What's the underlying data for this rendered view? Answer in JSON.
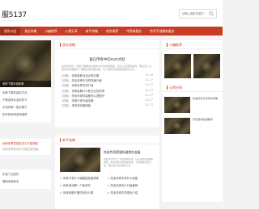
{
  "site": {
    "title": "服5137",
    "subtitle": "——————————————",
    "search_placeholder": "请输入搜索关键字..."
  },
  "nav": [
    "资讯公告",
    "现在攻略",
    "小编推荐",
    "心得分享",
    "新手攻略",
    "综合推荐",
    "传奇新服务",
    "传奇手游最新服务"
  ],
  "left": {
    "caption": "怎样下载手游传奇",
    "items": [
      "传奇下载安装的方法",
      "下载游戏手游怎样下",
      "手机传奇一般去哪下",
      "的手机传奇游戏推荐"
    ],
    "article_title": "传奇世界发新发怎么才能得到",
    "article_body": "传奇世界游戏中大家应该知道…",
    "bottom_items": [
      "手游了比较好",
      "最新传奇版本"
    ]
  },
  "mid": {
    "head": "现在攻略",
    "feature_title": "喜在传奇中的mds文结",
    "feature_body": "喜在传奇中，玩家们需要通过各种方式去获取装备，宝石以及其他道具，而在这个过程中玩家需要去了解相关的攻略内容。这个游戏中有很多装备可以打…",
    "list": [
      {
        "tag": "[攻略]",
        "text": "传奇各职业加点有问题",
        "date": "11-16"
      },
      {
        "tag": "[攻略]",
        "text": "热血传奇中怎样快速升级",
        "date": "11-17"
      },
      {
        "tag": "[攻略]",
        "text": "传奇世界怎样打宝",
        "date": "11-17"
      },
      {
        "tag": "[攻略]",
        "text": "传奇私服什么职业比较好练",
        "date": "11-17"
      },
      {
        "tag": "[攻略]",
        "text": "热血传奇的装备怎么搭配好",
        "date": "11-17"
      },
      {
        "tag": "[攻略]",
        "text": "传奇打怪升级攻略",
        "date": "11-17"
      },
      {
        "tag": "[攻略]",
        "text": "传奇游戏最新版",
        "date": "11-17"
      }
    ],
    "head2": "新手攻略",
    "feature2_title": "热血传奇需要知道哪些准备",
    "feature2_body": "热血传奇作为一款经典的游戏，玩家需要提前做好准备，熟悉游戏中的各种技能，了解装备搭配方法，做好战斗前的准备工作…",
    "list2": [
      {
        "text": "传奇中有什么隐藏技能值得练",
        "date": ""
      },
      {
        "text": "传奇游戏哪一个版本好",
        "date": ""
      },
      {
        "text": "传奇新服开服时间怎么看",
        "date": ""
      }
    ],
    "list2_right": [
      "热血传奇中有什么技能",
      "热血传奇怎么升级最快",
      "热血传奇中的角色介绍"
    ]
  },
  "right": {
    "head": "小编推荐",
    "head2": "心得分享",
    "items": [
      {
        "title": "热血传奇平民玩家攻略"
      },
      {
        "title": "传奇游戏私服推荐"
      }
    ]
  }
}
